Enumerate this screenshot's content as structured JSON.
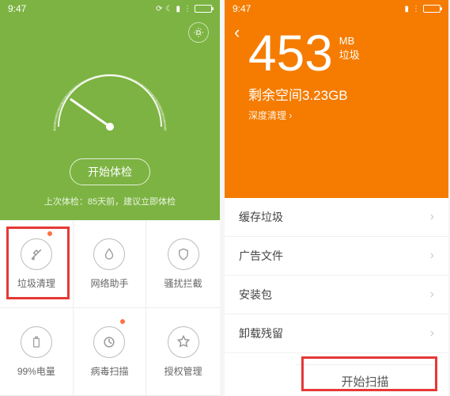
{
  "status": {
    "time": "9:47"
  },
  "screen1": {
    "start_btn": "开始体检",
    "last_check": "上次体检：85天前，建议立即体检",
    "cells": [
      {
        "label": "垃圾清理",
        "icon": "brush-icon",
        "dot": true
      },
      {
        "label": "网络助手",
        "icon": "drop-icon"
      },
      {
        "label": "骚扰拦截",
        "icon": "shield-icon"
      },
      {
        "label": "99%电量",
        "icon": "battery-icon"
      },
      {
        "label": "病毒扫描",
        "icon": "scan-icon",
        "dot": true
      },
      {
        "label": "授权管理",
        "icon": "star-icon"
      }
    ]
  },
  "screen2": {
    "big_num": "453",
    "unit": "MB",
    "unit_sub": "垃圾",
    "space_label": "剩余空间3.23GB",
    "deep_clean": "深度清理",
    "rows": [
      "缓存垃圾",
      "广告文件",
      "安装包",
      "卸载残留"
    ],
    "scan_btn": "开始扫描"
  }
}
